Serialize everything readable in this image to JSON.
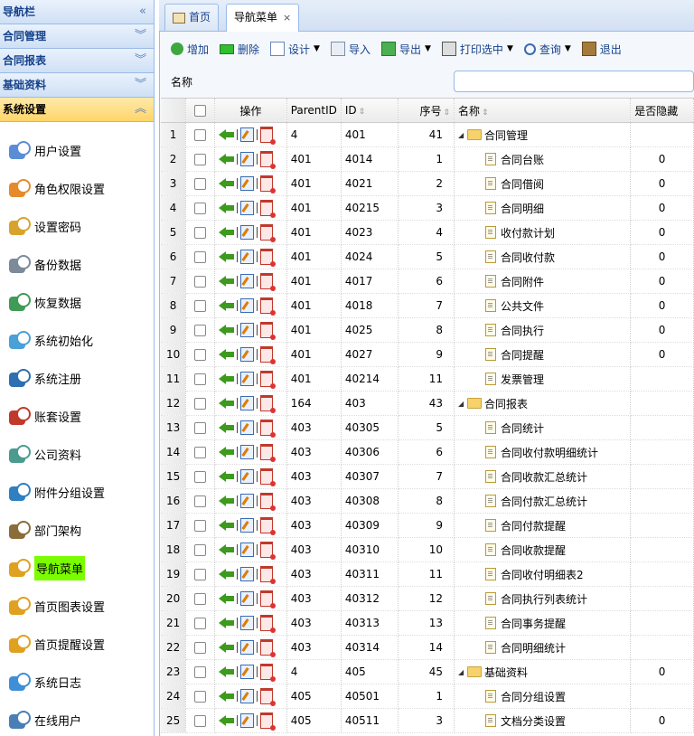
{
  "sidebar": {
    "header": "导航栏",
    "sections": [
      {
        "label": "合同管理"
      },
      {
        "label": "合同报表"
      },
      {
        "label": "基础资料"
      },
      {
        "label": "系统设置"
      }
    ],
    "items": [
      {
        "label": "用户设置",
        "icon": "users-icon"
      },
      {
        "label": "角色权限设置",
        "icon": "roles-icon"
      },
      {
        "label": "设置密码",
        "icon": "key-icon"
      },
      {
        "label": "备份数据",
        "icon": "database-backup-icon"
      },
      {
        "label": "恢复数据",
        "icon": "database-restore-icon"
      },
      {
        "label": "系统初始化",
        "icon": "blocks-icon"
      },
      {
        "label": "系统注册",
        "icon": "drill-icon"
      },
      {
        "label": "账套设置",
        "icon": "tools-icon"
      },
      {
        "label": "公司资料",
        "icon": "books-icon"
      },
      {
        "label": "附件分组设置",
        "icon": "group-icon"
      },
      {
        "label": "部门架构",
        "icon": "org-icon"
      },
      {
        "label": "导航菜单",
        "icon": "factory-icon"
      },
      {
        "label": "首页图表设置",
        "icon": "factory-icon"
      },
      {
        "label": "首页提醒设置",
        "icon": "factory-icon"
      },
      {
        "label": "系统日志",
        "icon": "log-icon"
      },
      {
        "label": "在线用户",
        "icon": "online-users-icon"
      }
    ]
  },
  "tabs": [
    {
      "label": "首页"
    },
    {
      "label": "导航菜单",
      "close": "×"
    }
  ],
  "toolbar": {
    "add": "增加",
    "delete": "删除",
    "design": "设计",
    "import": "导入",
    "export": "导出",
    "print": "打印选中",
    "query": "查询",
    "exit": "退出"
  },
  "search": {
    "label": "名称",
    "value": ""
  },
  "grid": {
    "columns": [
      "操作",
      "ParentID",
      "ID",
      "序号",
      "名称",
      "是否隐藏"
    ],
    "rows": [
      {
        "n": "1",
        "pid": "4",
        "id": "401",
        "seq": "41",
        "name": "合同管理",
        "folder": true,
        "hidden": ""
      },
      {
        "n": "2",
        "pid": "401",
        "id": "4014",
        "seq": "1",
        "name": "合同台账",
        "folder": false,
        "hidden": "0"
      },
      {
        "n": "3",
        "pid": "401",
        "id": "4021",
        "seq": "2",
        "name": "合同借阅",
        "folder": false,
        "hidden": "0"
      },
      {
        "n": "4",
        "pid": "401",
        "id": "40215",
        "seq": "3",
        "name": "合同明细",
        "folder": false,
        "hidden": "0"
      },
      {
        "n": "5",
        "pid": "401",
        "id": "4023",
        "seq": "4",
        "name": "收付款计划",
        "folder": false,
        "hidden": "0"
      },
      {
        "n": "6",
        "pid": "401",
        "id": "4024",
        "seq": "5",
        "name": "合同收付款",
        "folder": false,
        "hidden": "0"
      },
      {
        "n": "7",
        "pid": "401",
        "id": "4017",
        "seq": "6",
        "name": "合同附件",
        "folder": false,
        "hidden": "0"
      },
      {
        "n": "8",
        "pid": "401",
        "id": "4018",
        "seq": "7",
        "name": "公共文件",
        "folder": false,
        "hidden": "0"
      },
      {
        "n": "9",
        "pid": "401",
        "id": "4025",
        "seq": "8",
        "name": "合同执行",
        "folder": false,
        "hidden": "0"
      },
      {
        "n": "10",
        "pid": "401",
        "id": "4027",
        "seq": "9",
        "name": "合同提醒",
        "folder": false,
        "hidden": "0"
      },
      {
        "n": "11",
        "pid": "401",
        "id": "40214",
        "seq": "11",
        "name": "发票管理",
        "folder": false,
        "hidden": ""
      },
      {
        "n": "12",
        "pid": "164",
        "id": "403",
        "seq": "43",
        "name": "合同报表",
        "folder": true,
        "hidden": ""
      },
      {
        "n": "13",
        "pid": "403",
        "id": "40305",
        "seq": "5",
        "name": "合同统计",
        "folder": false,
        "hidden": ""
      },
      {
        "n": "14",
        "pid": "403",
        "id": "40306",
        "seq": "6",
        "name": "合同收付款明细统计",
        "folder": false,
        "hidden": ""
      },
      {
        "n": "15",
        "pid": "403",
        "id": "40307",
        "seq": "7",
        "name": "合同收款汇总统计",
        "folder": false,
        "hidden": ""
      },
      {
        "n": "16",
        "pid": "403",
        "id": "40308",
        "seq": "8",
        "name": "合同付款汇总统计",
        "folder": false,
        "hidden": ""
      },
      {
        "n": "17",
        "pid": "403",
        "id": "40309",
        "seq": "9",
        "name": "合同付款提醒",
        "folder": false,
        "hidden": ""
      },
      {
        "n": "18",
        "pid": "403",
        "id": "40310",
        "seq": "10",
        "name": "合同收款提醒",
        "folder": false,
        "hidden": ""
      },
      {
        "n": "19",
        "pid": "403",
        "id": "40311",
        "seq": "11",
        "name": "合同收付明细表2",
        "folder": false,
        "hidden": ""
      },
      {
        "n": "20",
        "pid": "403",
        "id": "40312",
        "seq": "12",
        "name": "合同执行列表统计",
        "folder": false,
        "hidden": ""
      },
      {
        "n": "21",
        "pid": "403",
        "id": "40313",
        "seq": "13",
        "name": "合同事务提醒",
        "folder": false,
        "hidden": ""
      },
      {
        "n": "22",
        "pid": "403",
        "id": "40314",
        "seq": "14",
        "name": "合同明细统计",
        "folder": false,
        "hidden": ""
      },
      {
        "n": "23",
        "pid": "4",
        "id": "405",
        "seq": "45",
        "name": "基础资料",
        "folder": true,
        "hidden": "0"
      },
      {
        "n": "24",
        "pid": "405",
        "id": "40501",
        "seq": "1",
        "name": "合同分组设置",
        "folder": false,
        "hidden": ""
      },
      {
        "n": "25",
        "pid": "405",
        "id": "40511",
        "seq": "3",
        "name": "文档分类设置",
        "folder": false,
        "hidden": "0"
      }
    ]
  }
}
